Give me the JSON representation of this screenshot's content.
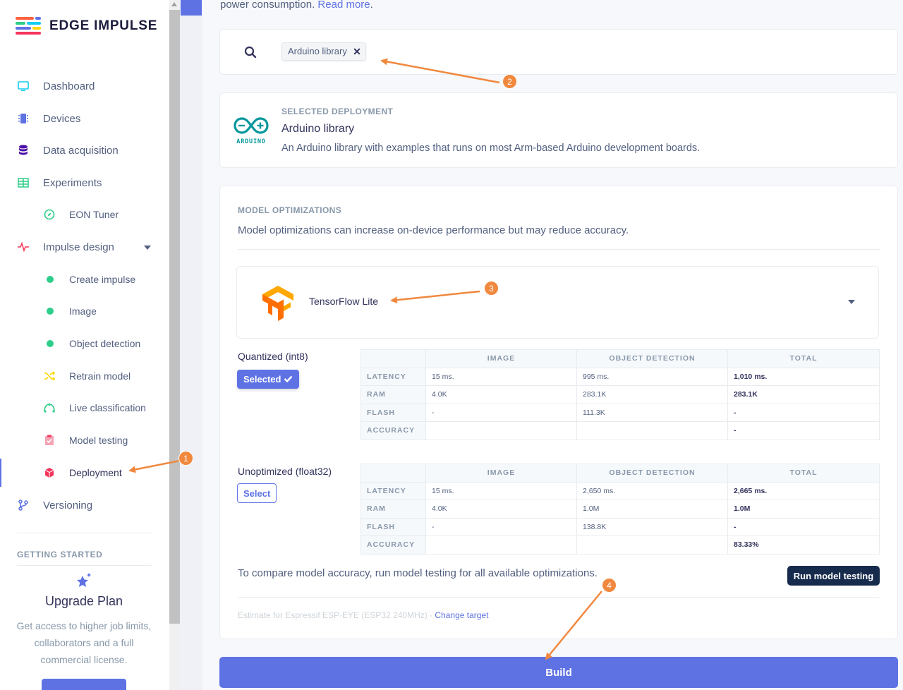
{
  "brand": {
    "name": "EDGE IMPULSE"
  },
  "sidebar": {
    "items": [
      {
        "label": "Dashboard",
        "icon": "monitor-icon"
      },
      {
        "label": "Devices",
        "icon": "chip-icon"
      },
      {
        "label": "Data acquisition",
        "icon": "database-icon"
      },
      {
        "label": "Experiments",
        "icon": "table-icon"
      },
      {
        "label": "EON Tuner",
        "icon": "compass-icon"
      },
      {
        "label": "Impulse design",
        "icon": "pulse-icon"
      },
      {
        "label": "Create impulse",
        "icon": "dot-icon"
      },
      {
        "label": "Image",
        "icon": "dot-icon"
      },
      {
        "label": "Object detection",
        "icon": "dot-icon"
      },
      {
        "label": "Retrain model",
        "icon": "shuffle-icon"
      },
      {
        "label": "Live classification",
        "icon": "live-icon"
      },
      {
        "label": "Model testing",
        "icon": "clipboard-check-icon"
      },
      {
        "label": "Deployment",
        "icon": "cube-icon"
      },
      {
        "label": "Versioning",
        "icon": "git-branch-icon"
      }
    ],
    "getting_started": "GETTING STARTED",
    "upgrade": {
      "title": "Upgrade Plan",
      "text": "Get access to higher job limits, collaborators and a full commercial license."
    }
  },
  "main": {
    "top_text": "power consumption.",
    "top_link": "Read more",
    "search_chip": "Arduino library",
    "selected": {
      "label": "SELECTED DEPLOYMENT",
      "title": "Arduino library",
      "description": "An Arduino library with examples that runs on most Arm-based Arduino development boards.",
      "logo_text": "ARDUINO"
    },
    "optimizations": {
      "label": "MODEL OPTIMIZATIONS",
      "description": "Model optimizations can increase on-device performance but may reduce accuracy.",
      "engine": "TensorFlow Lite"
    },
    "columns": [
      "",
      "IMAGE",
      "OBJECT DETECTION",
      "TOTAL"
    ],
    "quantized": {
      "title": "Quantized (int8)",
      "button": "Selected",
      "rows": [
        {
          "name": "LATENCY",
          "image": "15 ms.",
          "od": "995 ms.",
          "total": "1,010 ms."
        },
        {
          "name": "RAM",
          "image": "4.0K",
          "od": "283.1K",
          "total": "283.1K"
        },
        {
          "name": "FLASH",
          "image": "-",
          "od": "111.3K",
          "total": "-"
        },
        {
          "name": "ACCURACY",
          "image": "",
          "od": "",
          "total": "-"
        }
      ]
    },
    "unoptimized": {
      "title": "Unoptimized (float32)",
      "button": "Select",
      "rows": [
        {
          "name": "LATENCY",
          "image": "15 ms.",
          "od": "2,650 ms.",
          "total": "2,665 ms."
        },
        {
          "name": "RAM",
          "image": "4.0K",
          "od": "1.0M",
          "total": "1.0M"
        },
        {
          "name": "FLASH",
          "image": "-",
          "od": "138.8K",
          "total": "-"
        },
        {
          "name": "ACCURACY",
          "image": "",
          "od": "",
          "total": "83.33%"
        }
      ]
    },
    "compare_text": "To compare model accuracy, run model testing for all available optimizations.",
    "run_button": "Run model testing",
    "estimate_text": "Estimate for Espressif ESP-EYE (ESP32 240MHz) - ",
    "change_target": "Change target",
    "build_button": "Build"
  },
  "annotations": [
    "1",
    "2",
    "3",
    "4"
  ],
  "colors": {
    "accent": "#5e72e4",
    "annotation": "#f0883e",
    "dark": "#172b4d",
    "green": "#2dce89"
  }
}
